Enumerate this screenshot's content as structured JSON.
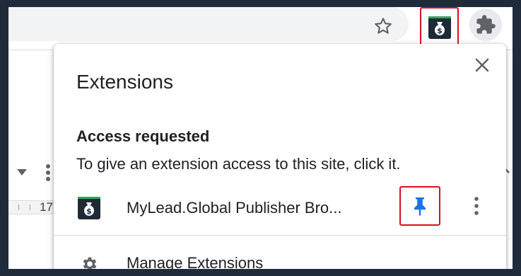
{
  "toolbar": {
    "bookmark_icon": "star-outline-icon",
    "pinned_extension_icon": "money-bag-icon",
    "extensions_icon": "puzzle-piece-icon"
  },
  "page_background": {
    "ruler_value": "17"
  },
  "popup": {
    "title": "Extensions",
    "close_icon": "close-icon",
    "section_heading": "Access requested",
    "section_description": "To give an extension access to this site, click it.",
    "extensions": [
      {
        "name": "MyLead.Global Publisher Bro...",
        "icon": "money-bag-icon",
        "pinned": true,
        "pin_icon": "pin-icon",
        "menu_icon": "more-vertical-icon"
      }
    ],
    "manage_label": "Manage Extensions",
    "manage_icon": "gear-icon"
  },
  "colors": {
    "highlight_border": "#d4121c",
    "pin_blue": "#1a73e8",
    "extension_icon_bg": "#1e2a36",
    "extension_icon_accent": "#34a853"
  }
}
